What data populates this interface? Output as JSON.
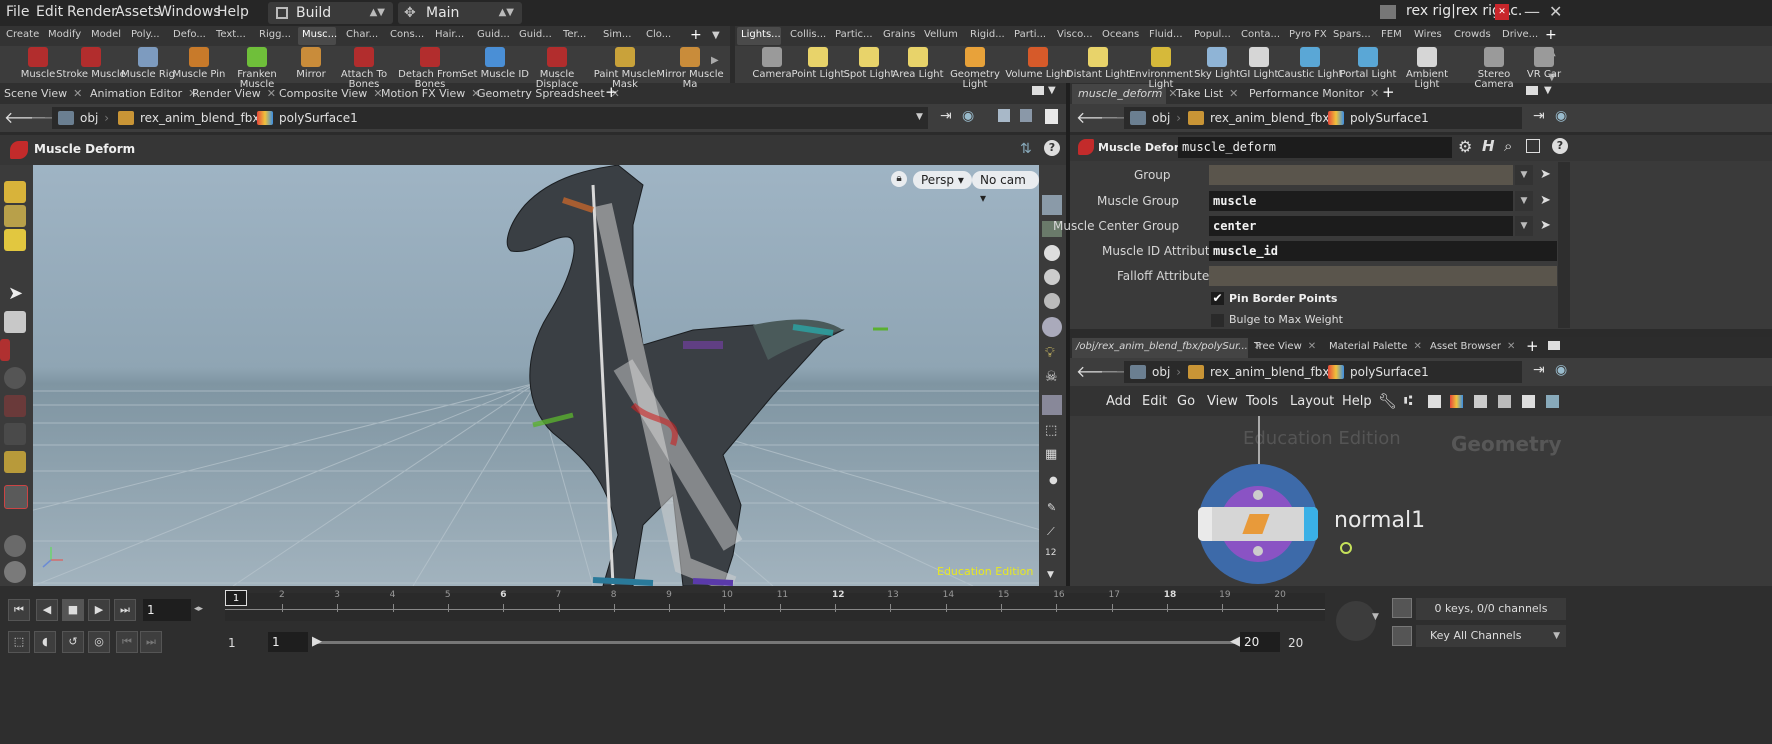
{
  "menu": {
    "items": [
      "File",
      "Edit",
      "Render",
      "Assets",
      "Windows",
      "Help"
    ],
    "desktop_label": "Build",
    "workspace_label": "Main",
    "title_text": "rex rig|rex rigAc."
  },
  "shelf_tabs_left": [
    "Create",
    "Modify",
    "Model",
    "Poly...",
    "Defo...",
    "Text...",
    "Rigg...",
    "Musc...",
    "Char...",
    "Cons...",
    "Hair...",
    "Guid...",
    "Guid...",
    "Ter...",
    "Sim...",
    "Clo..."
  ],
  "shelf_tabs_right": [
    "Lights...",
    "Collis...",
    "Partic...",
    "Grains",
    "Vellum",
    "Rigid...",
    "Parti...",
    "Visco...",
    "Oceans",
    "Fluid...",
    "Popul...",
    "Conta...",
    "Pyro FX",
    "Spars...",
    "FEM",
    "Wires",
    "Crowds",
    "Drive..."
  ],
  "shelf_tools_left": [
    {
      "label": "Muscle",
      "icon": "muscle-icon",
      "color": "#b22d2d"
    },
    {
      "label": "Stroke Muscle",
      "icon": "stroke-muscle-icon",
      "color": "#b22d2d"
    },
    {
      "label": "Muscle Rig",
      "icon": "muscle-rig-icon",
      "color": "#7d9bbf"
    },
    {
      "label": "Muscle Pin",
      "icon": "muscle-pin-icon",
      "color": "#c87a2a"
    },
    {
      "label": "Franken Muscle",
      "icon": "franken-muscle-icon",
      "color": "#6fbf3a"
    },
    {
      "label": "Mirror",
      "icon": "mirror-icon",
      "color": "#c98c3a"
    },
    {
      "label": "Attach To Bones",
      "icon": "attach-bones-icon",
      "color": "#b22d2d"
    },
    {
      "label": "Detach From Bones",
      "icon": "detach-bones-icon",
      "color": "#b22d2d"
    },
    {
      "label": "Set Muscle ID",
      "icon": "set-muscle-id-icon",
      "color": "#4a8fd6"
    },
    {
      "label": "Muscle Displace",
      "icon": "muscle-displace-icon",
      "color": "#b22d2d"
    },
    {
      "label": "Paint Muscle Mask",
      "icon": "paint-mask-icon",
      "color": "#c9a23a"
    },
    {
      "label": "Mirror Muscle Ma",
      "icon": "mirror-muscle-icon",
      "color": "#c98c3a"
    }
  ],
  "shelf_tools_right": [
    {
      "label": "Camera",
      "icon": "camera-icon",
      "color": "#9a9a9a"
    },
    {
      "label": "Point Light",
      "icon": "point-light-icon",
      "color": "#e8d36a"
    },
    {
      "label": "Spot Light",
      "icon": "spot-light-icon",
      "color": "#e8d36a"
    },
    {
      "label": "Area Light",
      "icon": "area-light-icon",
      "color": "#e8d36a"
    },
    {
      "label": "Geometry Light",
      "icon": "geometry-light-icon",
      "color": "#e8a23a"
    },
    {
      "label": "Volume Light",
      "icon": "volume-light-icon",
      "color": "#d65a2a"
    },
    {
      "label": "Distant Light",
      "icon": "distant-light-icon",
      "color": "#e8d36a"
    },
    {
      "label": "Environment Light",
      "icon": "environment-light-icon",
      "color": "#d6b93a"
    },
    {
      "label": "Sky Light",
      "icon": "sky-light-icon",
      "color": "#8fb4d6"
    },
    {
      "label": "GI Light",
      "icon": "gi-light-icon",
      "color": "#d6d6d6"
    },
    {
      "label": "Caustic Light",
      "icon": "caustic-light-icon",
      "color": "#5aa7d6"
    },
    {
      "label": "Portal Light",
      "icon": "portal-light-icon",
      "color": "#5aa7d6"
    },
    {
      "label": "Ambient Light",
      "icon": "ambient-light-icon",
      "color": "#d6d6d6"
    },
    {
      "label": "Stereo Camera",
      "icon": "stereo-camera-icon",
      "color": "#9a9a9a"
    },
    {
      "label": "VR Car",
      "icon": "vr-camera-icon",
      "color": "#9a9a9a"
    }
  ],
  "left_pane": {
    "tabs": [
      "Scene View",
      "Animation Editor",
      "Render View",
      "Composite View",
      "Motion FX View",
      "Geometry Spreadsheet"
    ],
    "path": [
      "obj",
      "rex_anim_blend_fbx",
      "polySurface1"
    ],
    "op_title": "Muscle Deform",
    "persp_label": "Persp",
    "cam_label": "No cam",
    "watermark": "Education Edition"
  },
  "right_top": {
    "tabs": [
      "muscle_deform",
      "Take List",
      "Performance Monitor"
    ],
    "path": [
      "obj",
      "rex_anim_blend_fbx",
      "polySurface1"
    ],
    "op_type": "Muscle Deform",
    "op_name": "muscle_deform",
    "params": [
      {
        "label": "Group",
        "value": ""
      },
      {
        "label": "Muscle Group",
        "value": "muscle"
      },
      {
        "label": "Muscle Center Group",
        "value": "center"
      },
      {
        "label": "Muscle ID Attribute",
        "value": "muscle_id"
      },
      {
        "label": "Falloff Attribute",
        "value": ""
      }
    ],
    "pin_border_label": "Pin Border Points",
    "pin_border_checked": true,
    "bulge_label": "Bulge to Max Weight",
    "bulge_checked": false
  },
  "right_bottom": {
    "tabs": [
      "/obj/rex_anim_blend_fbx/polySur...",
      "Tree View",
      "Material Palette",
      "Asset Browser"
    ],
    "path": [
      "obj",
      "rex_anim_blend_fbx",
      "polySurface1"
    ],
    "menu": [
      "Add",
      "Edit",
      "Go",
      "View",
      "Tools",
      "Layout",
      "Help"
    ],
    "watermark": "Education Edition",
    "context_label": "Geometry",
    "node_name": "normal1"
  },
  "timeline": {
    "current_frame": "1",
    "frame_marker": "1",
    "ticks": [
      "2",
      "3",
      "4",
      "5",
      "6",
      "7",
      "8",
      "9",
      "10",
      "11",
      "12",
      "13",
      "14",
      "15",
      "16",
      "17",
      "18",
      "19",
      "20"
    ],
    "range_start": "1",
    "range_start2": "1",
    "range_end": "20",
    "range_end2": "20",
    "keys_text": "0 keys, 0/0 channels",
    "key_channels_label": "Key All Channels"
  }
}
